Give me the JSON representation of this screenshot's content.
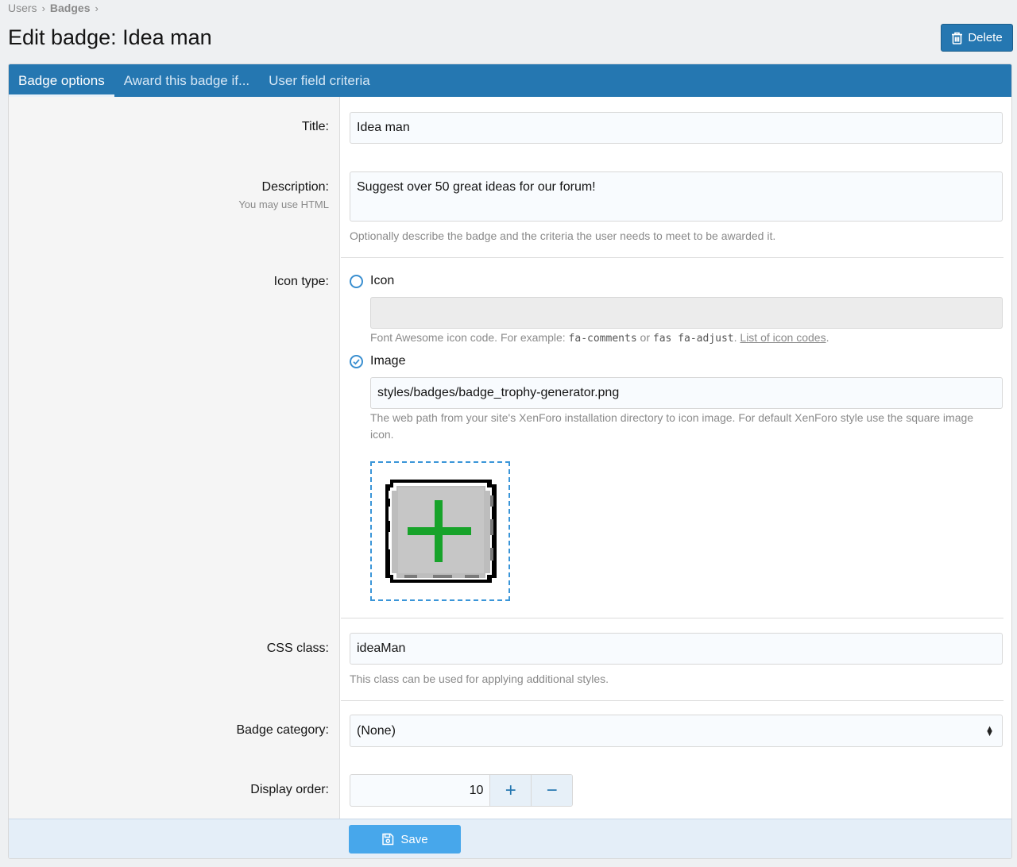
{
  "breadcrumb": {
    "items": [
      "Users",
      "Badges"
    ]
  },
  "page": {
    "title": "Edit badge: Idea man"
  },
  "toolbar": {
    "delete_label": "Delete",
    "delete_icon": "trash-icon"
  },
  "tabs": [
    {
      "label": "Badge options",
      "active": true
    },
    {
      "label": "Award this badge if...",
      "active": false
    },
    {
      "label": "User field criteria",
      "active": false
    }
  ],
  "form": {
    "title": {
      "label": "Title:",
      "value": "Idea man"
    },
    "description": {
      "label": "Description:",
      "hint": "You may use HTML",
      "value": "Suggest over 50 great ideas for our forum!",
      "explain": "Optionally describe the badge and the criteria the user needs to meet to be awarded it."
    },
    "icon_type": {
      "label": "Icon type:",
      "options": [
        {
          "label": "Icon",
          "checked": false,
          "value": "",
          "explain_prefix": "Font Awesome icon code. For example: ",
          "code1": "fa-comments",
          "explain_or": " or ",
          "code2": "fas fa-adjust",
          "explain_sep": ". ",
          "link": "List of icon codes",
          "explain_end": "."
        },
        {
          "label": "Image",
          "checked": true,
          "value": "styles/badges/badge_trophy-generator.png",
          "explain": "The web path from your site's XenForo installation directory to icon image. For default XenForo style use the square image icon."
        }
      ],
      "preview_icon": "badge-image-preview"
    },
    "css_class": {
      "label": "CSS class:",
      "value": "ideaMan",
      "explain": "This class can be used for applying additional styles."
    },
    "badge_category": {
      "label": "Badge category:",
      "value": "(None)"
    },
    "display_order": {
      "label": "Display order:",
      "value": "10",
      "plus": "+",
      "minus": "−"
    }
  },
  "footer": {
    "save_label": "Save",
    "save_icon": "save-icon"
  },
  "colors": {
    "accent": "#2577b1",
    "save": "#47a7eb",
    "preview_border": "#3a95d8",
    "plus_green": "#17a32a"
  }
}
